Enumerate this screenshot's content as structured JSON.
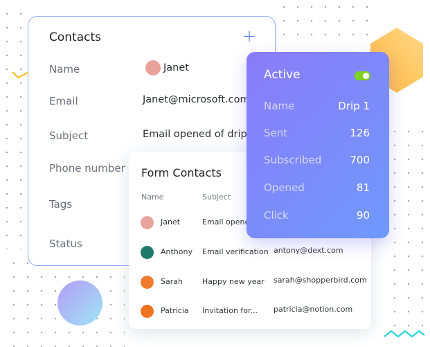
{
  "contacts": {
    "title": "Contacts",
    "add_icon": "plus-icon",
    "fields": {
      "name_label": "Name",
      "name_value": "Janet",
      "email_label": "Email",
      "email_value": "Janet@microsoft.com",
      "subject_label": "Subject",
      "subject_value": "Email opened of drip",
      "phone_label": "Phone number",
      "tags_label": "Tags",
      "status_label": "Status"
    }
  },
  "form_contacts": {
    "title": "Form Contacts",
    "headers": [
      "Name",
      "Subject"
    ],
    "rows": [
      {
        "name": "Janet",
        "subject": "Email opened",
        "email": "",
        "avatar_color": "#e8a39b"
      },
      {
        "name": "Anthony",
        "subject": "Email verification",
        "email": "antony@dext.com",
        "avatar_color": "#1f7a6a"
      },
      {
        "name": "Sarah",
        "subject": "Happy new year",
        "email": "sarah@shopperbird.com",
        "avatar_color": "#f07d2e"
      },
      {
        "name": "Patricia",
        "subject": "Invitation for...",
        "email": "patricia@notion.com",
        "avatar_color": "#f0721e"
      }
    ]
  },
  "drip": {
    "title": "Active",
    "toggle_on": true,
    "toggle_color": "#7ed321",
    "rows": [
      {
        "label": "Name",
        "value": "Drip 1"
      },
      {
        "label": "Sent",
        "value": "126"
      },
      {
        "label": "Subscribed",
        "value": "700"
      },
      {
        "label": "Opened",
        "value": "81"
      },
      {
        "label": "Click",
        "value": "90"
      }
    ]
  }
}
